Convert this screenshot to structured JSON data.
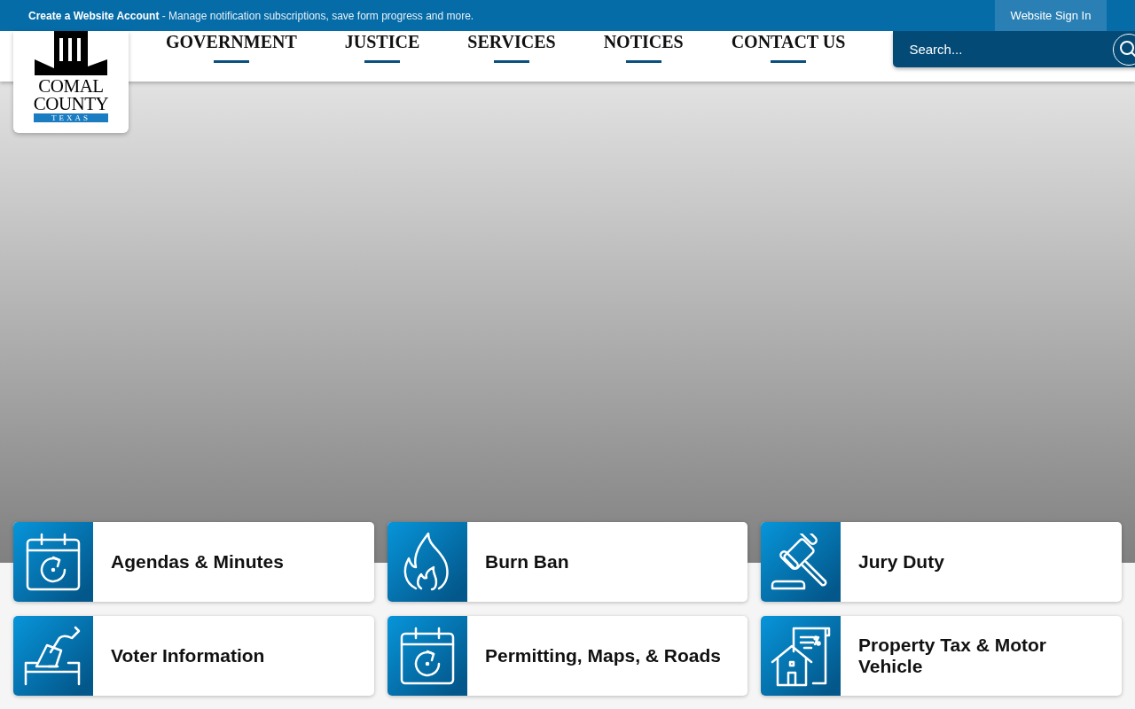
{
  "top_bar": {
    "account_link": "Create a Website Account",
    "account_text": " - Manage notification subscriptions, save form progress and more.",
    "sign_in": "Website Sign In"
  },
  "logo": {
    "line_1": "COMAL",
    "line_2": "COUNTY",
    "line_3": "TEXAS"
  },
  "nav": [
    "GOVERNMENT",
    "JUSTICE",
    "SERVICES",
    "NOTICES",
    "CONTACT US"
  ],
  "search": {
    "placeholder": "Search..."
  },
  "quick_links": [
    {
      "label": "Agendas & Minutes",
      "kind": "calendar"
    },
    {
      "label": "Burn Ban",
      "kind": "flame"
    },
    {
      "label": "Jury Duty",
      "kind": "gavel"
    },
    {
      "label": "Voter Information",
      "kind": "ballot"
    },
    {
      "label": "Permitting, Maps, & Roads",
      "kind": "calendar"
    },
    {
      "label": "Property Tax & Motor Vehicle",
      "kind": "house"
    }
  ]
}
